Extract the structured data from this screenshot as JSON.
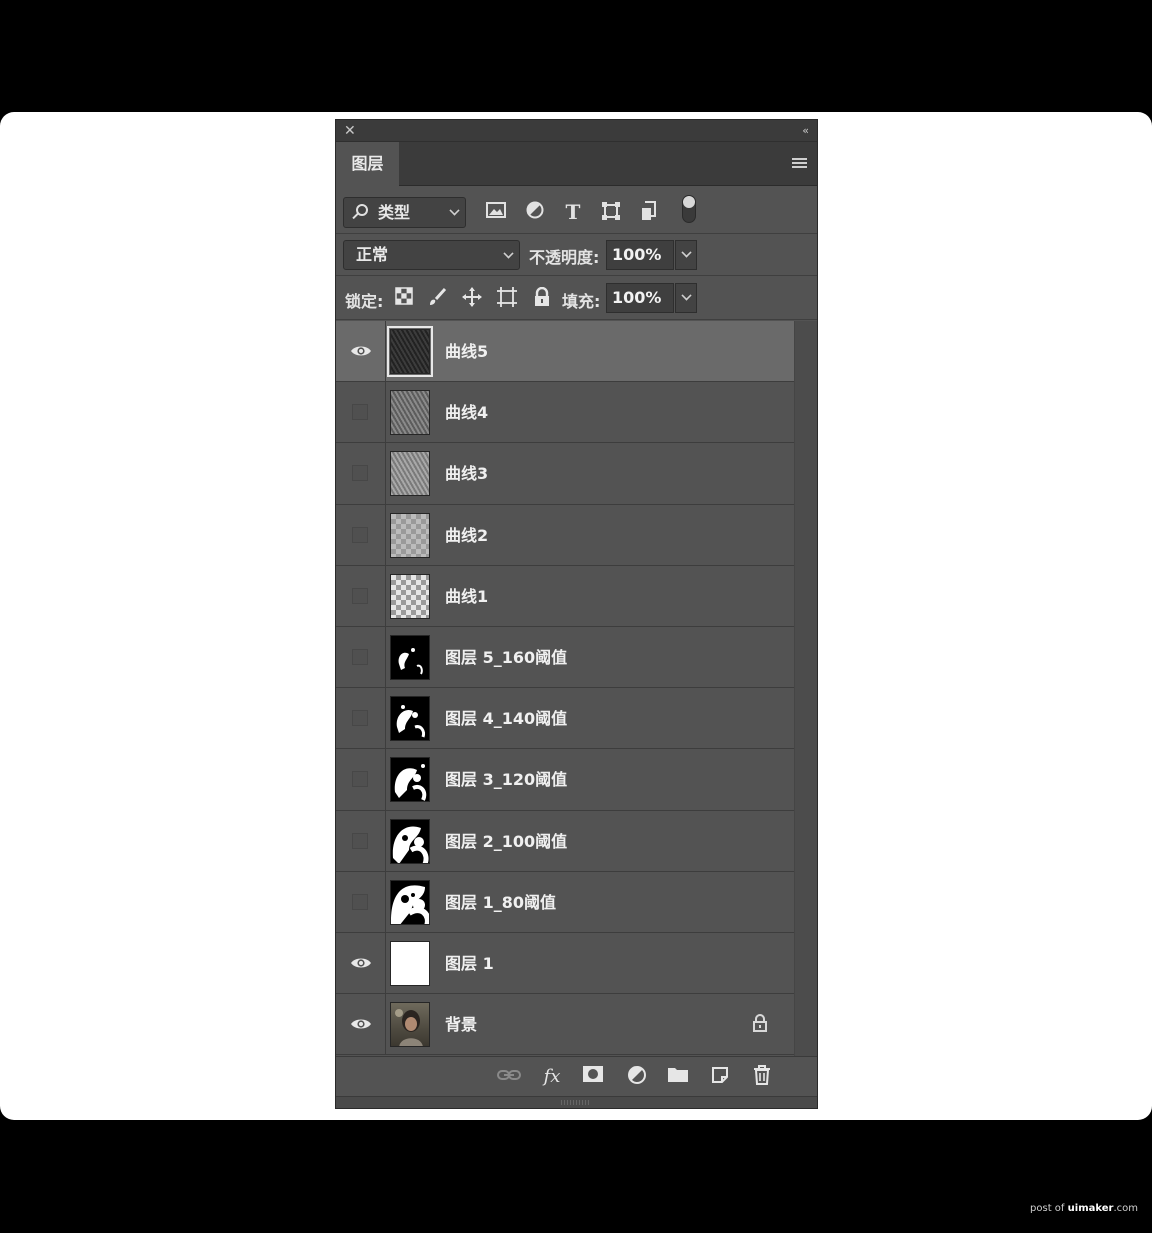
{
  "panel": {
    "tab_label": "图层",
    "filter": {
      "selected": "类型"
    },
    "blend": {
      "mode": "正常",
      "opacity_label": "不透明度:",
      "opacity_value": "100%"
    },
    "lock": {
      "label": "锁定:",
      "fill_label": "填充:",
      "fill_value": "100%"
    }
  },
  "layers": [
    {
      "name": "曲线5",
      "visible": true,
      "selected": true
    },
    {
      "name": "曲线4",
      "visible": false
    },
    {
      "name": "曲线3",
      "visible": false
    },
    {
      "name": "曲线2",
      "visible": false
    },
    {
      "name": "曲线1",
      "visible": false
    },
    {
      "name": "图层 5_160阈值",
      "visible": false
    },
    {
      "name": "图层 4_140阈值",
      "visible": false
    },
    {
      "name": "图层 3_120阈值",
      "visible": false
    },
    {
      "name": "图层 2_100阈值",
      "visible": false
    },
    {
      "name": "图层 1_80阈值",
      "visible": false
    },
    {
      "name": "图层 1",
      "visible": true
    },
    {
      "name": "背景",
      "visible": true,
      "locked": true
    }
  ],
  "watermark": {
    "prefix": "post of",
    "site": "uimaker",
    "suffix": ".com"
  }
}
